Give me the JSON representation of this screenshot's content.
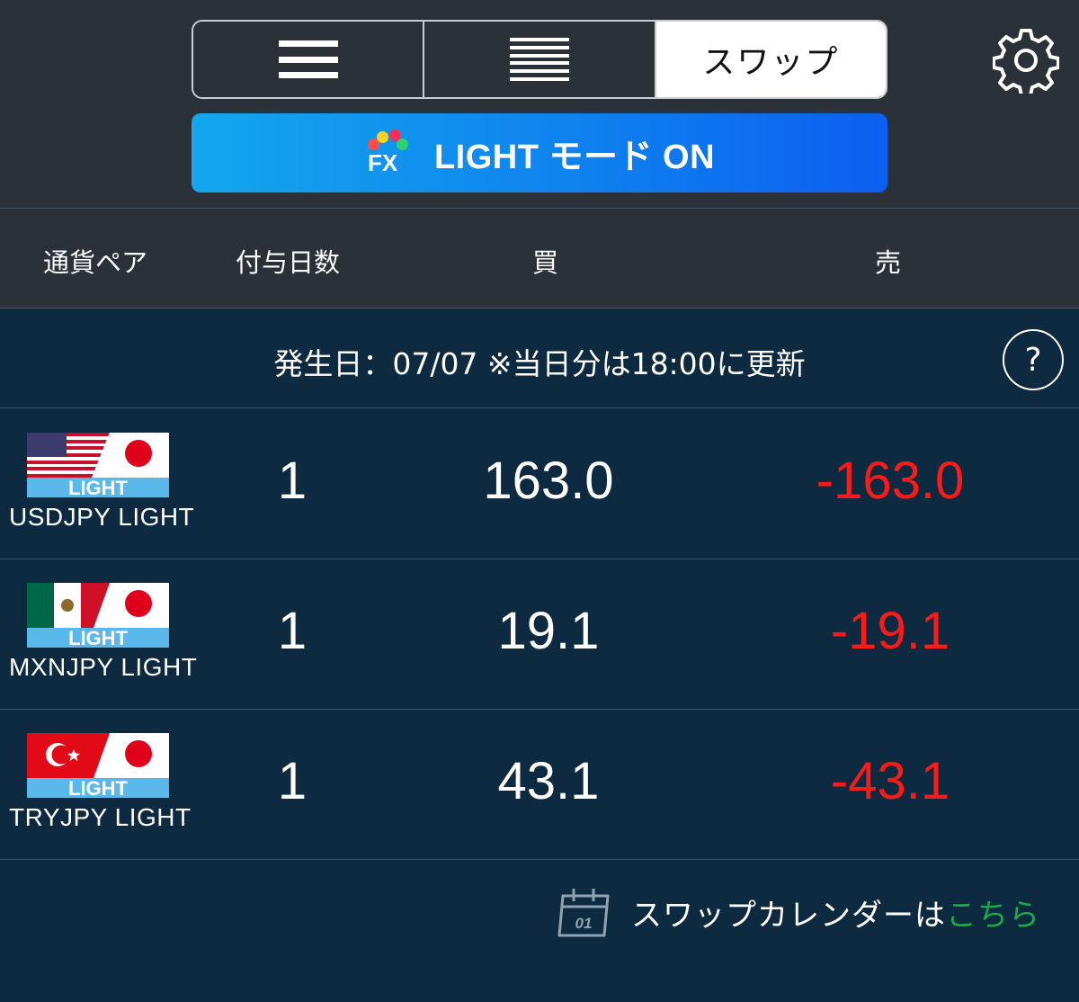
{
  "colors": {
    "negative": "#ff1a1a",
    "link": "#1ea84a",
    "light_badge": "#5ab8ea",
    "japan_red": "#e0001b"
  },
  "segment": {
    "tabs": [
      {
        "icon": "three-lines-icon",
        "label": ""
      },
      {
        "icon": "many-lines-icon",
        "label": ""
      },
      {
        "label": "スワップ",
        "active": true
      }
    ]
  },
  "settings_icon": "gear-icon",
  "light_mode": {
    "logo_text": "FX",
    "label": "LIGHT モード ON"
  },
  "columns": {
    "pair": "通貨ペア",
    "days": "付与日数",
    "buy": "買",
    "sell": "売"
  },
  "info": {
    "text": "発生日：07/07 ※当日分は18:00に更新",
    "help_label": "?"
  },
  "rows": [
    {
      "name": "USDJPY LIGHT",
      "flag": "us-jp-flag",
      "badge": "LIGHT",
      "days": "1",
      "buy": "163.0",
      "sell": "-163.0"
    },
    {
      "name": "MXNJPY LIGHT",
      "flag": "mx-jp-flag",
      "badge": "LIGHT",
      "days": "1",
      "buy": "19.1",
      "sell": "-19.1"
    },
    {
      "name": "TRYJPY LIGHT",
      "flag": "tr-jp-flag",
      "badge": "LIGHT",
      "days": "1",
      "buy": "43.1",
      "sell": "-43.1"
    }
  ],
  "calendar_link": {
    "icon_day": "01",
    "text": "スワップカレンダーは",
    "link_text": "こちら"
  }
}
